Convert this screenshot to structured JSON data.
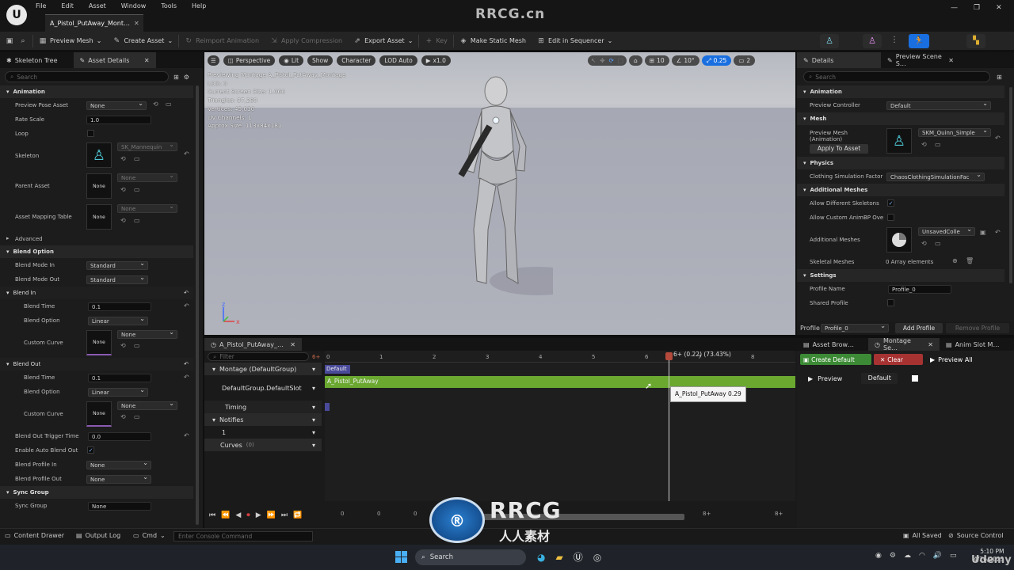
{
  "menu": [
    "File",
    "Edit",
    "Asset",
    "Window",
    "Tools",
    "Help"
  ],
  "doc_tab": "A_Pistol_PutAway_Mont…",
  "watermark": "RRCG.cn",
  "toolbar": {
    "preview_mesh": "Preview Mesh",
    "create_asset": "Create Asset",
    "reimport": "Reimport Animation",
    "apply_compression": "Apply Compression",
    "export_asset": "Export Asset",
    "key": "Key",
    "make_static_mesh": "Make Static Mesh",
    "edit_in_sequencer": "Edit in Sequencer"
  },
  "left": {
    "tabs": [
      "Skeleton Tree",
      "Asset Details"
    ],
    "search_placeholder": "Search",
    "animation": {
      "title": "Animation",
      "preview_pose_asset_label": "Preview Pose Asset",
      "preview_pose_asset": "None",
      "rate_scale_label": "Rate Scale",
      "rate_scale": "1.0",
      "loop_label": "Loop",
      "skeleton_label": "Skeleton",
      "skeleton": "SK_Mannequin",
      "parent_asset_label": "Parent Asset",
      "parent_asset": "None",
      "parent_thumb": "None",
      "mapping_label": "Asset Mapping Table",
      "mapping": "None",
      "mapping_thumb": "None"
    },
    "advanced": "Advanced",
    "blend_option": {
      "title": "Blend Option",
      "mode_in_label": "Blend Mode In",
      "mode_in": "Standard",
      "mode_out_label": "Blend Mode Out",
      "mode_out": "Standard"
    },
    "blend_in": {
      "title": "Blend In",
      "time_label": "Blend Time",
      "time": "0.1",
      "option_label": "Blend Option",
      "option": "Linear",
      "curve_label": "Custom Curve",
      "curve": "None",
      "curve_thumb": "None"
    },
    "blend_out": {
      "title": "Blend Out",
      "time_label": "Blend Time",
      "time": "0.1",
      "option_label": "Blend Option",
      "option": "Linear",
      "curve_label": "Custom Curve",
      "curve": "None",
      "curve_thumb": "None"
    },
    "trigger_label": "Blend Out Trigger Time",
    "trigger": "0.0",
    "auto_blend_label": "Enable Auto Blend Out",
    "profile_in_label": "Blend Profile In",
    "profile_in": "None",
    "profile_out_label": "Blend Profile Out",
    "profile_out": "None",
    "sync_title": "Sync Group",
    "sync_label": "Sync Group",
    "sync": "None"
  },
  "viewport": {
    "perspective": "Perspective",
    "lit": "Lit",
    "show": "Show",
    "character": "Character",
    "lod": "LOD Auto",
    "speed": "x1.0",
    "grid": "10",
    "angle": "10°",
    "scale": "0.25",
    "cam": "2",
    "stats": [
      "Previewing Montage A_Pistol_PutAway_Montage",
      "LOD: 0",
      "Current Screen Size: 1.066",
      "Triangles: 87,280",
      "Vertices: 45,030",
      "UV Channels: 1",
      "Approx Size: 113x84x181"
    ],
    "axis_z": "z",
    "axis_x": "x"
  },
  "timeline": {
    "tab": "A_Pistol_PutAway_…",
    "filter_placeholder": "Filter",
    "frame_marker": "6+",
    "montage_group": "Montage (DefaultGroup)",
    "default_slot": "DefaultGroup.DefaultSlot",
    "timing": "Timing",
    "notifies": "Notifies",
    "notify_track": "1",
    "curves": "Curves",
    "curves_count": "(0)",
    "ticks": [
      "0",
      "1",
      "2",
      "3",
      "4",
      "5",
      "6",
      "7",
      "8"
    ],
    "playhead_label": "6+ (0.22) (73.43%)",
    "section_label": "Default",
    "segment_label": "A_Pistol_PutAway",
    "tooltip": "A_Pistol_PutAway 0.29",
    "playback_values": [
      "0",
      "0",
      "0",
      "8+",
      "8+"
    ]
  },
  "details": {
    "tabs": [
      "Details",
      "Preview Scene S…"
    ],
    "search_placeholder": "Search",
    "animation_title": "Animation",
    "preview_controller_label": "Preview Controller",
    "preview_controller": "Default",
    "mesh_title": "Mesh",
    "preview_mesh_label": "Preview Mesh\n(Animation)",
    "preview_mesh": "SKM_Quinn_Simple",
    "apply_to_asset": "Apply To Asset",
    "physics_title": "Physics",
    "clothing_label": "Clothing Simulation Factor",
    "clothing": "ChaosClothingSimulationFac",
    "additional_title": "Additional Meshes",
    "allow_diff_label": "Allow Different Skeletons",
    "allow_custom_label": "Allow Custom AnimBP Ove",
    "additional_label": "Additional Meshes",
    "additional": "UnsavedColle",
    "skeletal_label": "Skeletal Meshes",
    "skeletal": "0 Array elements",
    "settings_title": "Settings",
    "profile_name_label": "Profile Name",
    "profile_name": "Profile_0",
    "shared_label": "Shared Profile",
    "profile_label": "Profile",
    "profile": "Profile_0",
    "add_profile": "Add Profile",
    "remove_profile": "Remove Profile"
  },
  "montage_panel": {
    "tabs": [
      "Asset Brow…",
      "Montage Se…",
      "Anim Slot M…"
    ],
    "create_default": "Create Default",
    "clear": "Clear",
    "preview_all": "Preview All",
    "preview": "Preview",
    "default": "Default"
  },
  "status": {
    "content_drawer": "Content Drawer",
    "output_log": "Output Log",
    "cmd": "Cmd",
    "console_placeholder": "Enter Console Command",
    "all_saved": "All Saved",
    "source_control": "Source Control"
  },
  "taskbar": {
    "search": "Search",
    "time": "5:10 PM",
    "date": "4/26/2023"
  },
  "logo": {
    "big": "RRCG",
    "small": "人人素材",
    "udemy": "Udemy"
  },
  "colors": {
    "accent": "#1a6fe0",
    "segment": "#6aa830",
    "create_default": "#3c8a35",
    "clear": "#a73232",
    "playhead": "#b34a3c"
  }
}
